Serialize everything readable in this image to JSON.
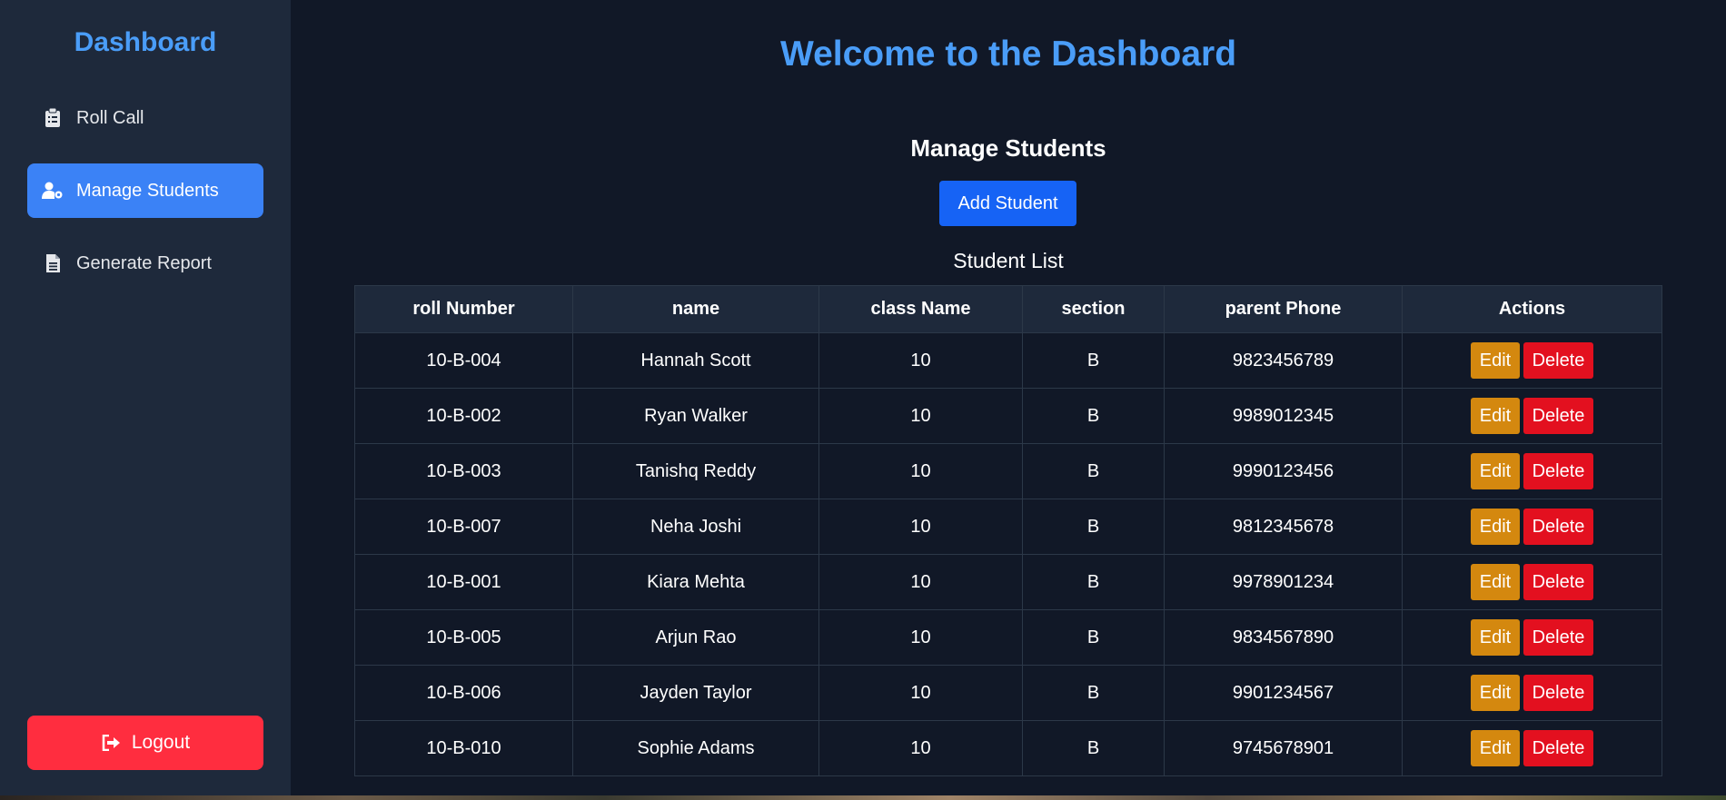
{
  "sidebar": {
    "brand": "Dashboard",
    "items": [
      {
        "label": "Roll Call",
        "icon": "clipboard-list-icon"
      },
      {
        "label": "Manage Students",
        "icon": "user-gear-icon"
      },
      {
        "label": "Generate Report",
        "icon": "file-text-icon"
      }
    ],
    "active_index": 1,
    "logout_label": "Logout",
    "logout_icon": "sign-out-icon"
  },
  "main": {
    "welcome": "Welcome to the Dashboard",
    "section_title": "Manage Students",
    "add_button": "Add Student",
    "list_title": "Student List"
  },
  "table": {
    "columns": [
      "roll Number",
      "name",
      "class Name",
      "section",
      "parent Phone",
      "Actions"
    ],
    "edit_label": "Edit",
    "delete_label": "Delete",
    "rows": [
      [
        "10-B-004",
        "Hannah Scott",
        "10",
        "B",
        "9823456789"
      ],
      [
        "10-B-002",
        "Ryan Walker",
        "10",
        "B",
        "9989012345"
      ],
      [
        "10-B-003",
        "Tanishq Reddy",
        "10",
        "B",
        "9990123456"
      ],
      [
        "10-B-007",
        "Neha Joshi",
        "10",
        "B",
        "9812345678"
      ],
      [
        "10-B-001",
        "Kiara Mehta",
        "10",
        "B",
        "9978901234"
      ],
      [
        "10-B-005",
        "Arjun Rao",
        "10",
        "B",
        "9834567890"
      ],
      [
        "10-B-006",
        "Jayden Taylor",
        "10",
        "B",
        "9901234567"
      ],
      [
        "10-B-010",
        "Sophie Adams",
        "10",
        "B",
        "9745678901"
      ]
    ]
  },
  "colors": {
    "sidebar_bg": "#1e293b",
    "main_bg": "#111827",
    "brand": "#4a9df8",
    "active_nav": "#3b82f6",
    "primary_button": "#1663f5",
    "edit_button": "#d4880f",
    "delete_button": "#e3101f",
    "logout_button": "#ff2d3f"
  }
}
